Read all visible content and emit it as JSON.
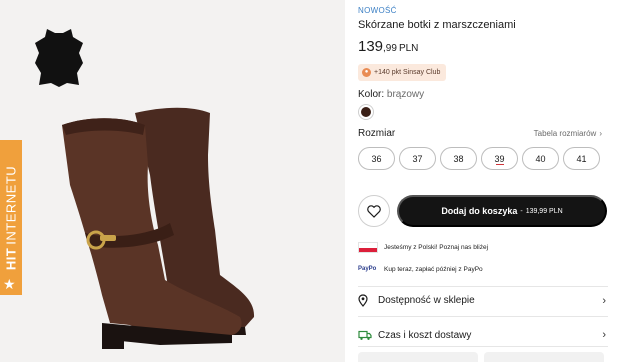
{
  "image": {
    "hit_badge": {
      "bold": "HIT",
      "text": "INTERNETU"
    },
    "icons": {
      "leather": "leather-hide-icon",
      "star": "star-icon"
    }
  },
  "product": {
    "new_label": "NOWOŚĆ",
    "name": "Skórzane botki z marszczeniami",
    "price": {
      "main": "139",
      "cents": ",99",
      "currency": "PLN"
    },
    "club": {
      "text": "+140 pkt Sinsay Club",
      "icon": "club-coin-icon"
    }
  },
  "color": {
    "label": "Kolor:",
    "value": "brązowy",
    "swatch_hex": "#3a1f16"
  },
  "sizes": {
    "label": "Rozmiar",
    "table_link": "Tabela rozmiarów",
    "options": [
      "36",
      "37",
      "38",
      "39",
      "40",
      "41"
    ],
    "low_stock": "39"
  },
  "actions": {
    "cart_label": "Dodaj do koszyka",
    "cart_sep": "-",
    "cart_price": "139,99 PLN"
  },
  "info": {
    "poland": "Jesteśmy z Polski! Poznaj nas bliżej",
    "paypo_logo": "PayPo",
    "paypo": "Kup teraz, zapłać później z PayPo"
  },
  "links": {
    "store": "Dostępność w sklepie",
    "delivery": "Czas i koszt dostawy"
  },
  "colors": {
    "accent_blue": "#3b7fc4",
    "badge_orange": "#f0a03c",
    "button_black": "#141414",
    "delivery_green": "#2e8b3d"
  }
}
